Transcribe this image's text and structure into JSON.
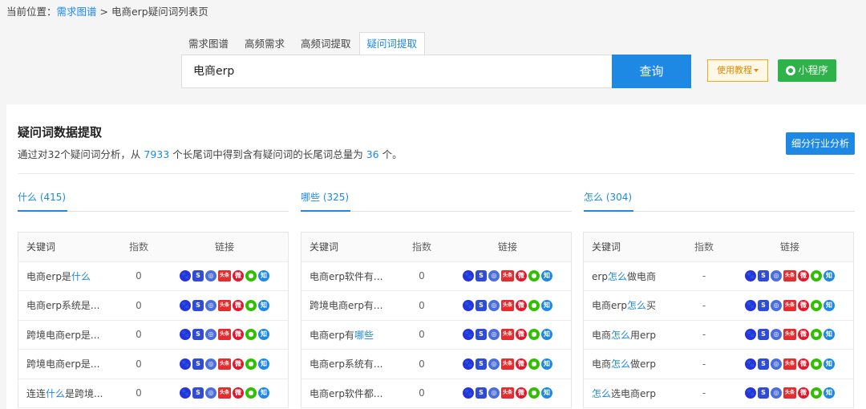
{
  "breadcrumb": {
    "prefix": "当前位置：",
    "link": "需求图谱",
    "sep": " > ",
    "current": "电商erp疑问词列表页"
  },
  "tabs": [
    "需求图谱",
    "高频需求",
    "高频词提取",
    "疑问词提取"
  ],
  "active_tab": "疑问词提取",
  "search": {
    "value": "电商erp",
    "button": "查询"
  },
  "tutorial_button": "使用教程",
  "mini_program_button": "小程序",
  "section": {
    "title": "疑问词数据提取",
    "desc_a": "通过对32个疑问词分析，从",
    "total_long_tail": "7933",
    "desc_b": "个长尾词中得到含有疑问词的长尾词总量为",
    "question_total": "36",
    "desc_c": "个。",
    "industry_button": "细分行业分析"
  },
  "table_headers": {
    "keyword": "关键词",
    "index": "指数",
    "links": "链接"
  },
  "link_icons": [
    {
      "name": "baidu-icon",
      "glyph": "🐾"
    },
    {
      "name": "sougou-icon",
      "glyph": "S"
    },
    {
      "name": "so360-icon",
      "glyph": "◎"
    },
    {
      "name": "toutiao-icon",
      "glyph": "头条"
    },
    {
      "name": "weibo-icon",
      "glyph": "微"
    },
    {
      "name": "wechat-icon",
      "glyph": "●"
    },
    {
      "name": "zhihu-icon",
      "glyph": "知"
    }
  ],
  "columns": [
    {
      "label": "什么 (415)",
      "rows": [
        {
          "pre": "电商erp是",
          "hl": "什么",
          "post": "",
          "index": "0"
        },
        {
          "pre": "电商erp系统是...",
          "hl": "",
          "post": "",
          "index": "0"
        },
        {
          "pre": "跨境电商erp是...",
          "hl": "",
          "post": "",
          "index": "0"
        },
        {
          "pre": "跨境电商erp是...",
          "hl": "",
          "post": "",
          "index": "0"
        },
        {
          "pre": "连连",
          "hl": "什么",
          "post": "是跨境...",
          "index": "0"
        }
      ]
    },
    {
      "label": "哪些 (325)",
      "rows": [
        {
          "pre": "电商erp软件有...",
          "hl": "",
          "post": "",
          "index": "0"
        },
        {
          "pre": "跨境电商erp有...",
          "hl": "",
          "post": "",
          "index": "0"
        },
        {
          "pre": "电商erp有",
          "hl": "哪些",
          "post": "",
          "index": "0"
        },
        {
          "pre": "电商erp系统有...",
          "hl": "",
          "post": "",
          "index": "0"
        },
        {
          "pre": "电商erp软件都...",
          "hl": "",
          "post": "",
          "index": "0"
        }
      ]
    },
    {
      "label": "怎么 (304)",
      "rows": [
        {
          "pre": "erp",
          "hl": "怎么",
          "post": "做电商",
          "index": "-"
        },
        {
          "pre": "电商erp",
          "hl": "怎么",
          "post": "买",
          "index": "-"
        },
        {
          "pre": "电商",
          "hl": "怎么",
          "post": "用erp",
          "index": "-"
        },
        {
          "pre": "电商",
          "hl": "怎么",
          "post": "做erp",
          "index": "-"
        },
        {
          "pre": "",
          "hl": "怎么",
          "post": "选电商erp",
          "index": "-"
        }
      ]
    }
  ]
}
